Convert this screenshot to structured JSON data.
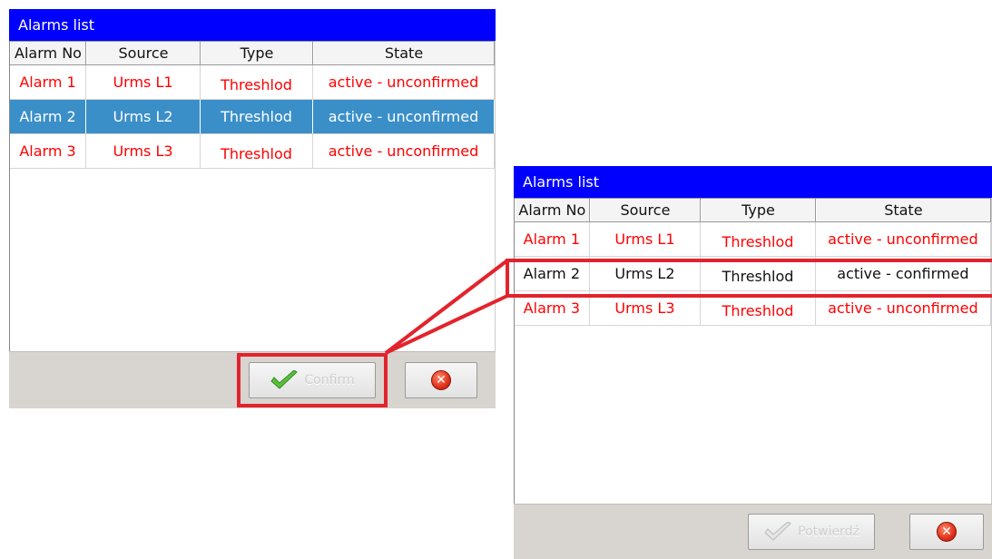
{
  "left_window": {
    "title": "Alarms list",
    "columns": [
      "Alarm No",
      "Source",
      "Type",
      "State"
    ],
    "rows": [
      {
        "alarm_no": "Alarm 1",
        "source": "Urms L1",
        "type": "Threshlod",
        "state": "active - unconfirmed"
      },
      {
        "alarm_no": "Alarm 2",
        "source": "Urms L2",
        "type": "Threshlod",
        "state": "active - unconfirmed"
      },
      {
        "alarm_no": "Alarm 3",
        "source": "Urms L3",
        "type": "Threshlod",
        "state": "active - unconfirmed"
      }
    ],
    "confirm_label": "Confirm"
  },
  "right_window": {
    "title": "Alarms list",
    "columns": [
      "Alarm No",
      "Source",
      "Type",
      "State"
    ],
    "rows": [
      {
        "alarm_no": "Alarm 1",
        "source": "Urms L1",
        "type": "Threshlod",
        "state": "active - unconfirmed"
      },
      {
        "alarm_no": "Alarm 2",
        "source": "Urms L2",
        "type": "Threshlod",
        "state": "active - confirmed"
      },
      {
        "alarm_no": "Alarm 3",
        "source": "Urms L3",
        "type": "Threshlod",
        "state": "active - unconfirmed"
      }
    ],
    "confirm_label": "Potwierdź"
  },
  "icons": {
    "confirm": "checkmark-icon",
    "close": "close-icon"
  },
  "colors": {
    "titlebar": "#0000ff",
    "alarm_text": "#ff0000",
    "selected_row": "#3a8fc8",
    "highlight": "#e3232c"
  }
}
